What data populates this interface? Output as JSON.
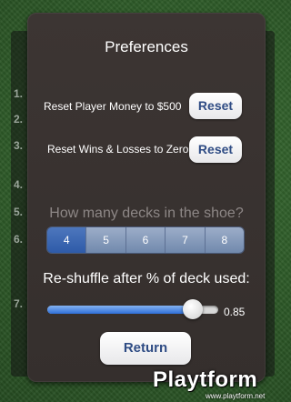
{
  "background_row_numbers": [
    "1.",
    "2.",
    "3.",
    "4.",
    "5.",
    "6.",
    "7."
  ],
  "dialog": {
    "title": "Preferences",
    "reset_money": {
      "label": "Reset Player Money to $500",
      "button": "Reset"
    },
    "reset_wins": {
      "label": "Reset Wins & Losses to Zero",
      "button": "Reset"
    },
    "decks": {
      "label": "How many decks in the shoe?",
      "options": [
        "4",
        "5",
        "6",
        "7",
        "8"
      ],
      "selected": "4"
    },
    "reshuffle": {
      "label": "Re-shuffle after % of deck used:",
      "value": 0.85,
      "value_text": "0.85"
    },
    "return_button": "Return"
  },
  "watermark": {
    "brand": "Playtform",
    "url": "www.playtform.net"
  },
  "colors": {
    "felt": "#2e5a28",
    "panel": "#3a3331",
    "button_text": "#2f4c84",
    "segment_selected": "#3a66b0",
    "segment": "#8197b9",
    "slider_fill": "#2f6fd8",
    "muted_text": "#8d8786"
  }
}
